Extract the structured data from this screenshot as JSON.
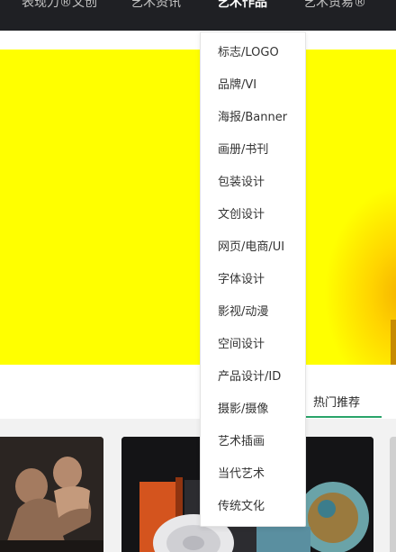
{
  "nav": {
    "items": [
      {
        "label": "表现力®文创"
      },
      {
        "label": "艺术资讯"
      },
      {
        "label": "艺术作品"
      },
      {
        "label": "艺术贸易®"
      }
    ]
  },
  "dropdown": {
    "items": [
      "标志/LOGO",
      "品牌/VI",
      "海报/Banner",
      "画册/书刊",
      "包装设计",
      "文创设计",
      "网页/电商/UI",
      "字体设计",
      "影视/动漫",
      "空间设计",
      "产品设计/ID",
      "摄影/摄像",
      "艺术插画",
      "当代艺术",
      "传统文化"
    ]
  },
  "tabs": {
    "hot_label": "热门推荐"
  },
  "colors": {
    "nav_bg": "#1f2024",
    "banner_bg": "#ffff00",
    "tab_accent": "#2aa46a"
  }
}
